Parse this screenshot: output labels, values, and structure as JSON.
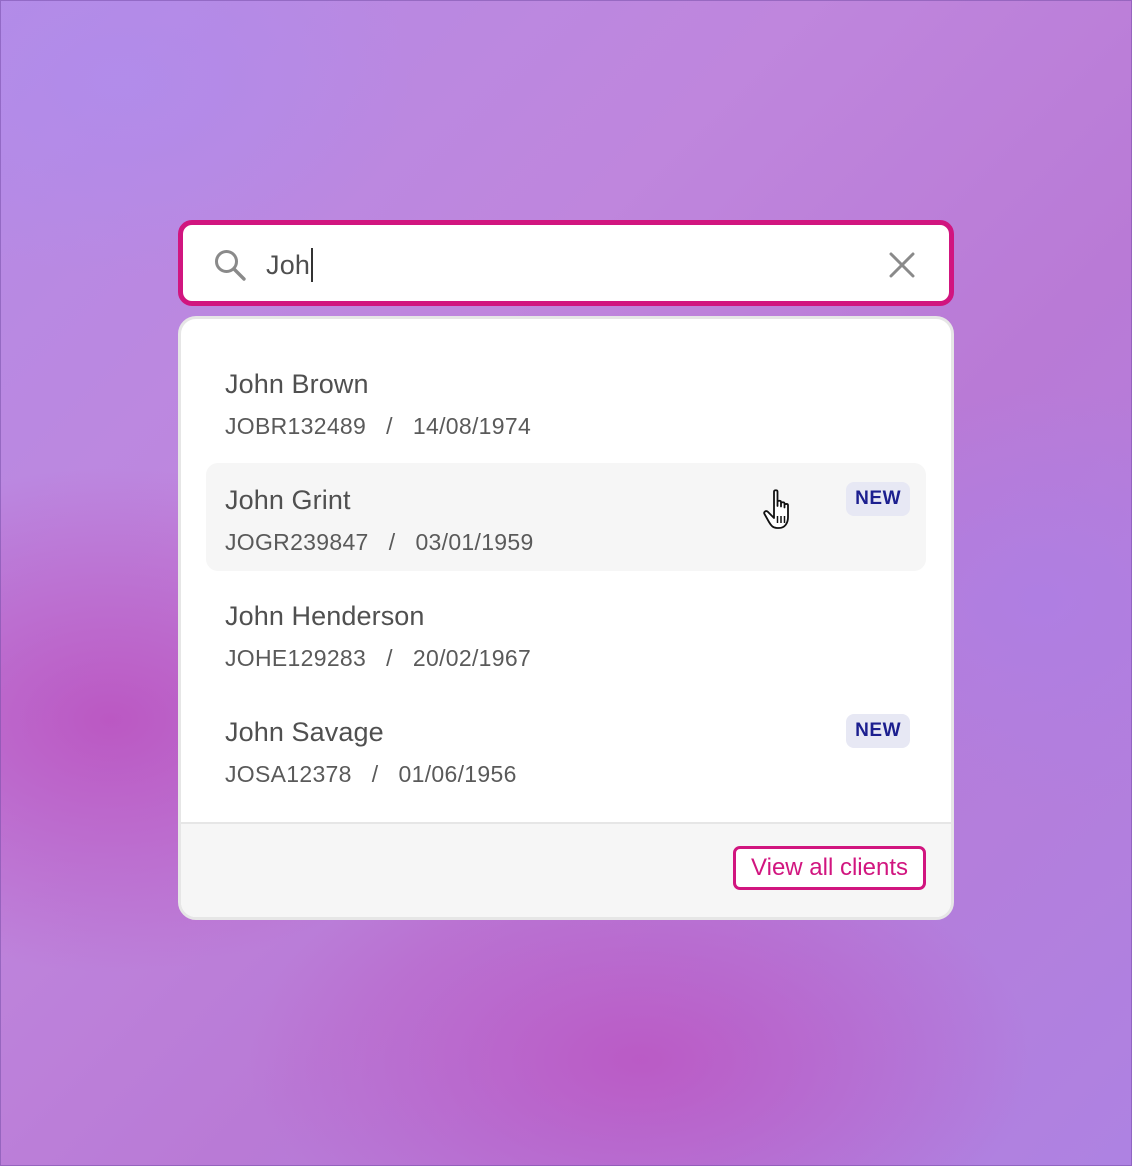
{
  "search": {
    "value": "Joh"
  },
  "results": [
    {
      "name": "John Brown",
      "meta": "JOBR132489   /   14/08/1974",
      "badge": ""
    },
    {
      "name": "John Grint",
      "meta": "JOGR239847   /   03/01/1959",
      "badge": "NEW"
    },
    {
      "name": "John Henderson",
      "meta": "JOHE129283   /   20/02/1967",
      "badge": ""
    },
    {
      "name": "John Savage",
      "meta": "JOSA12378   /   01/06/1956",
      "badge": "NEW"
    }
  ],
  "footer": {
    "view_all_label": "View all clients"
  },
  "colors": {
    "accent": "#d1157f",
    "badge_text": "#1c1f8f",
    "badge_bg": "#e7e8f4",
    "hover_row": "#f6f6f6"
  },
  "icons": {
    "search": "search-icon",
    "clear": "close-icon",
    "cursor": "hand-pointer-icon"
  }
}
